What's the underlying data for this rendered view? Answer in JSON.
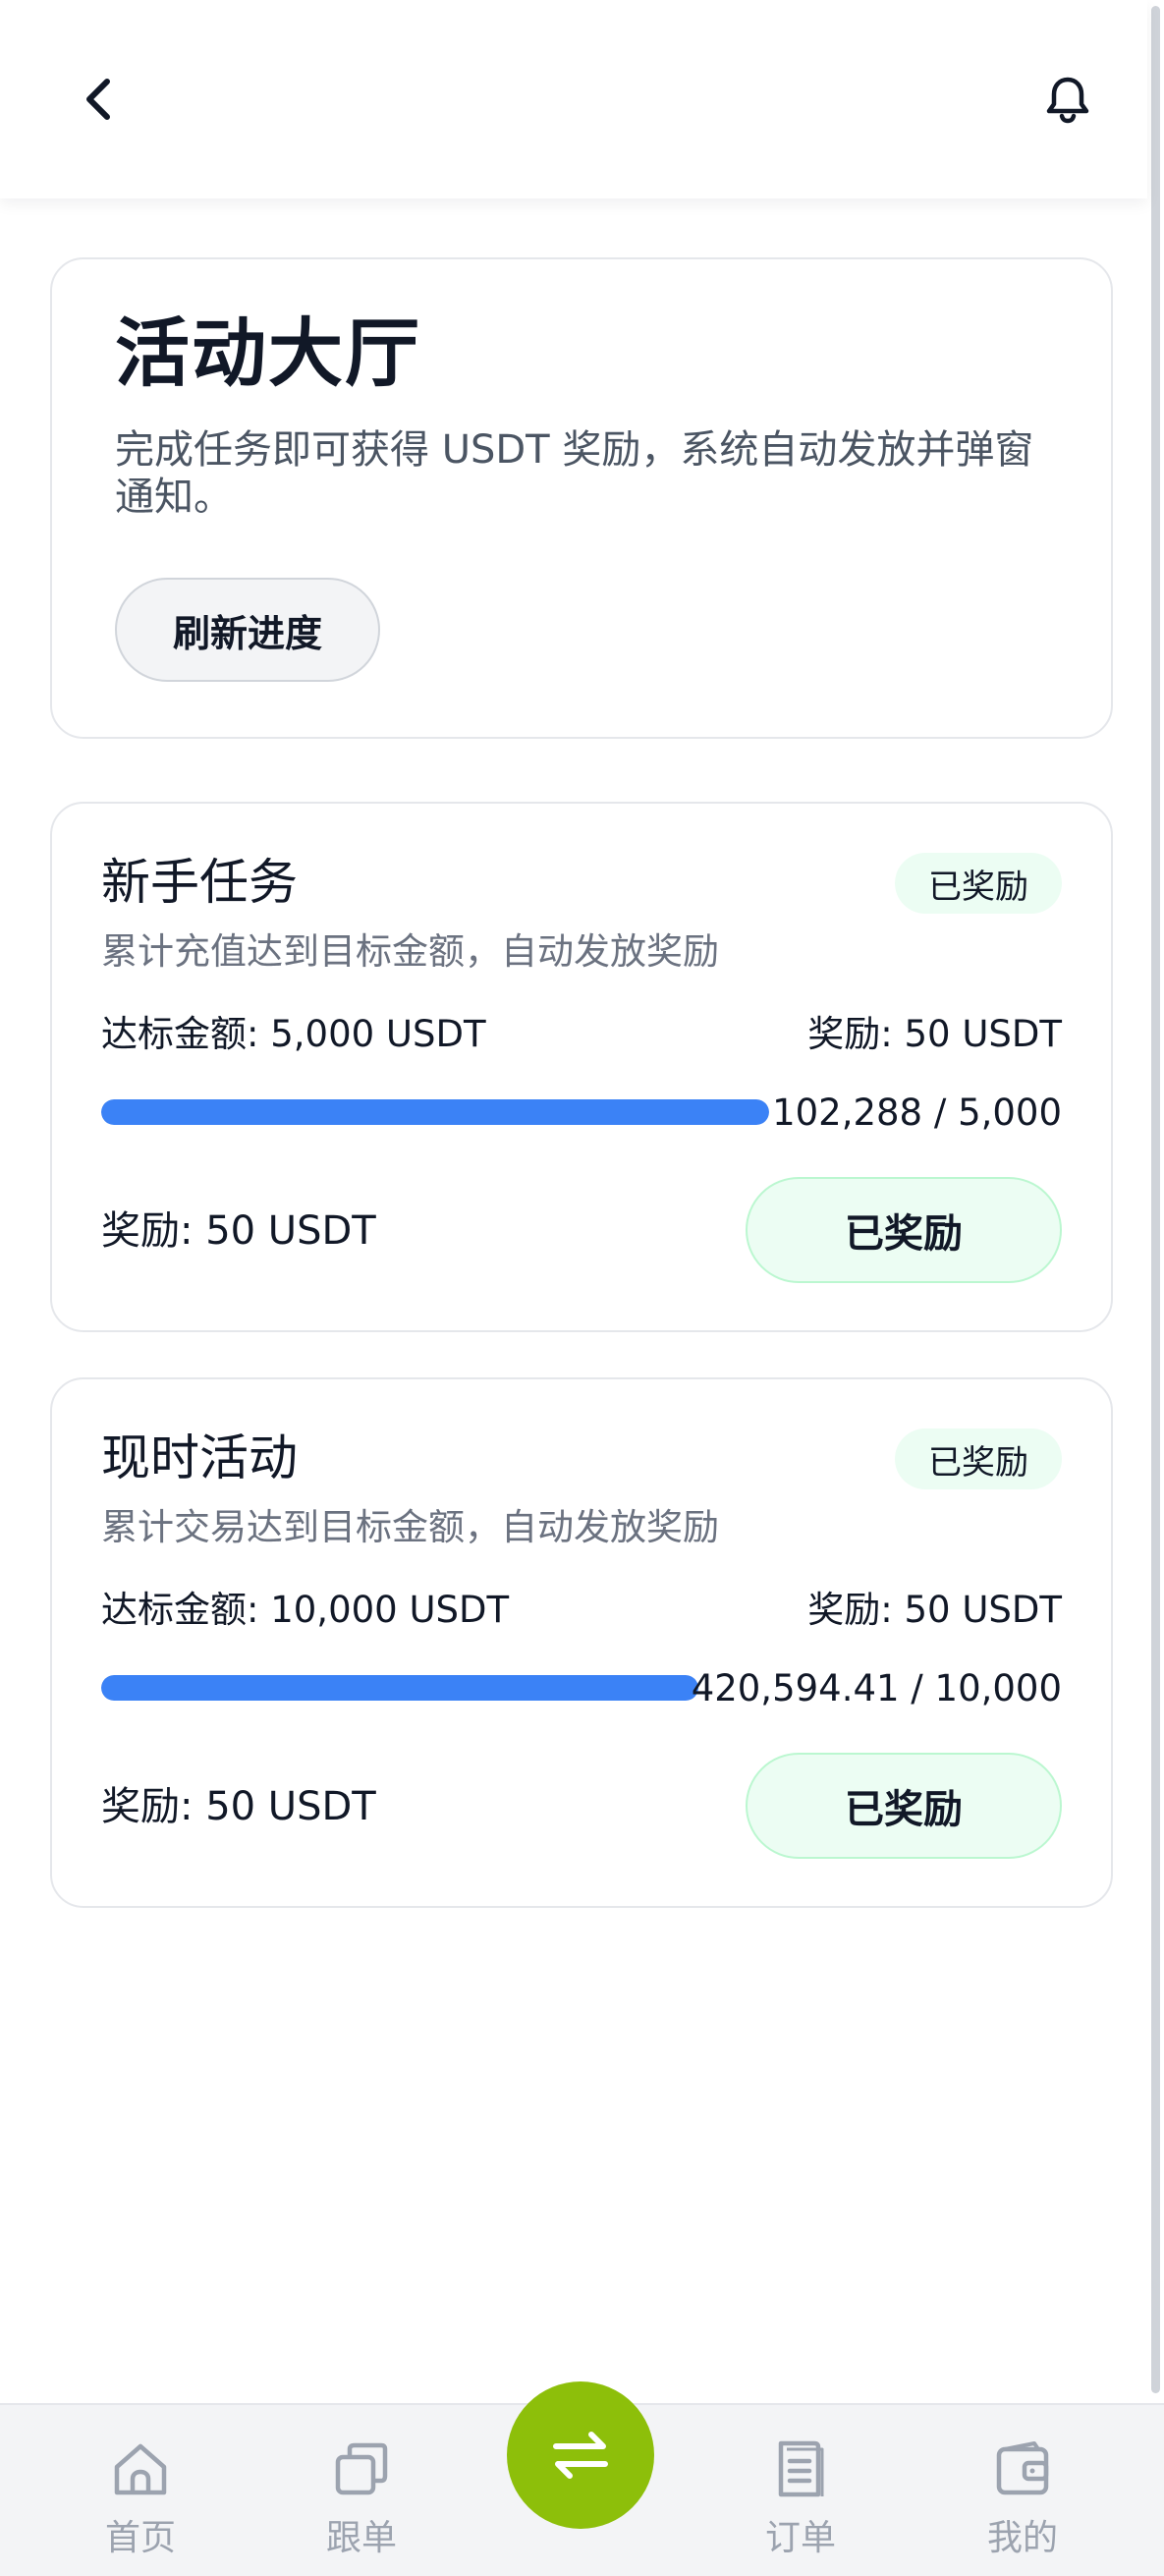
{
  "header": {
    "back_icon": "chevron-left-icon",
    "notification_icon": "bell-icon"
  },
  "hero": {
    "title": "活动大厅",
    "description": "完成任务即可获得 USDT 奖励，系统自动发放并弹窗通知。",
    "refresh_label": "刷新进度"
  },
  "tasks": [
    {
      "title": "新手任务",
      "status": "已奖励",
      "description": "累计充值达到目标金额，自动发放奖励",
      "target": "达标金额: 5,000 USDT",
      "reward": "奖励: 50 USDT",
      "progress_text": "102,288 / 5,000",
      "progress_fraction": 1.0,
      "reward_bottom": "奖励: 50 USDT",
      "button_label": "已奖励"
    },
    {
      "title": "现时活动",
      "status": "已奖励",
      "description": "累计交易达到目标金额，自动发放奖励",
      "target": "达标金额: 10,000 USDT",
      "reward": "奖励: 50 USDT",
      "progress_text": "420,594.41 / 10,000",
      "progress_fraction": 1.0,
      "reward_bottom": "奖励: 50 USDT",
      "button_label": "已奖励"
    }
  ],
  "bottom_nav": {
    "items": [
      {
        "label": "首页",
        "icon": "home-icon"
      },
      {
        "label": "跟单",
        "icon": "copy-icon"
      },
      {
        "label": "订单",
        "icon": "document-icon"
      },
      {
        "label": "我的",
        "icon": "wallet-icon"
      }
    ],
    "center_icon": "swap-arrows-icon"
  },
  "colors": {
    "accent_blue": "#3b82f6",
    "accent_green": "#8dbf0a",
    "status_bg": "#ecfdf3"
  }
}
